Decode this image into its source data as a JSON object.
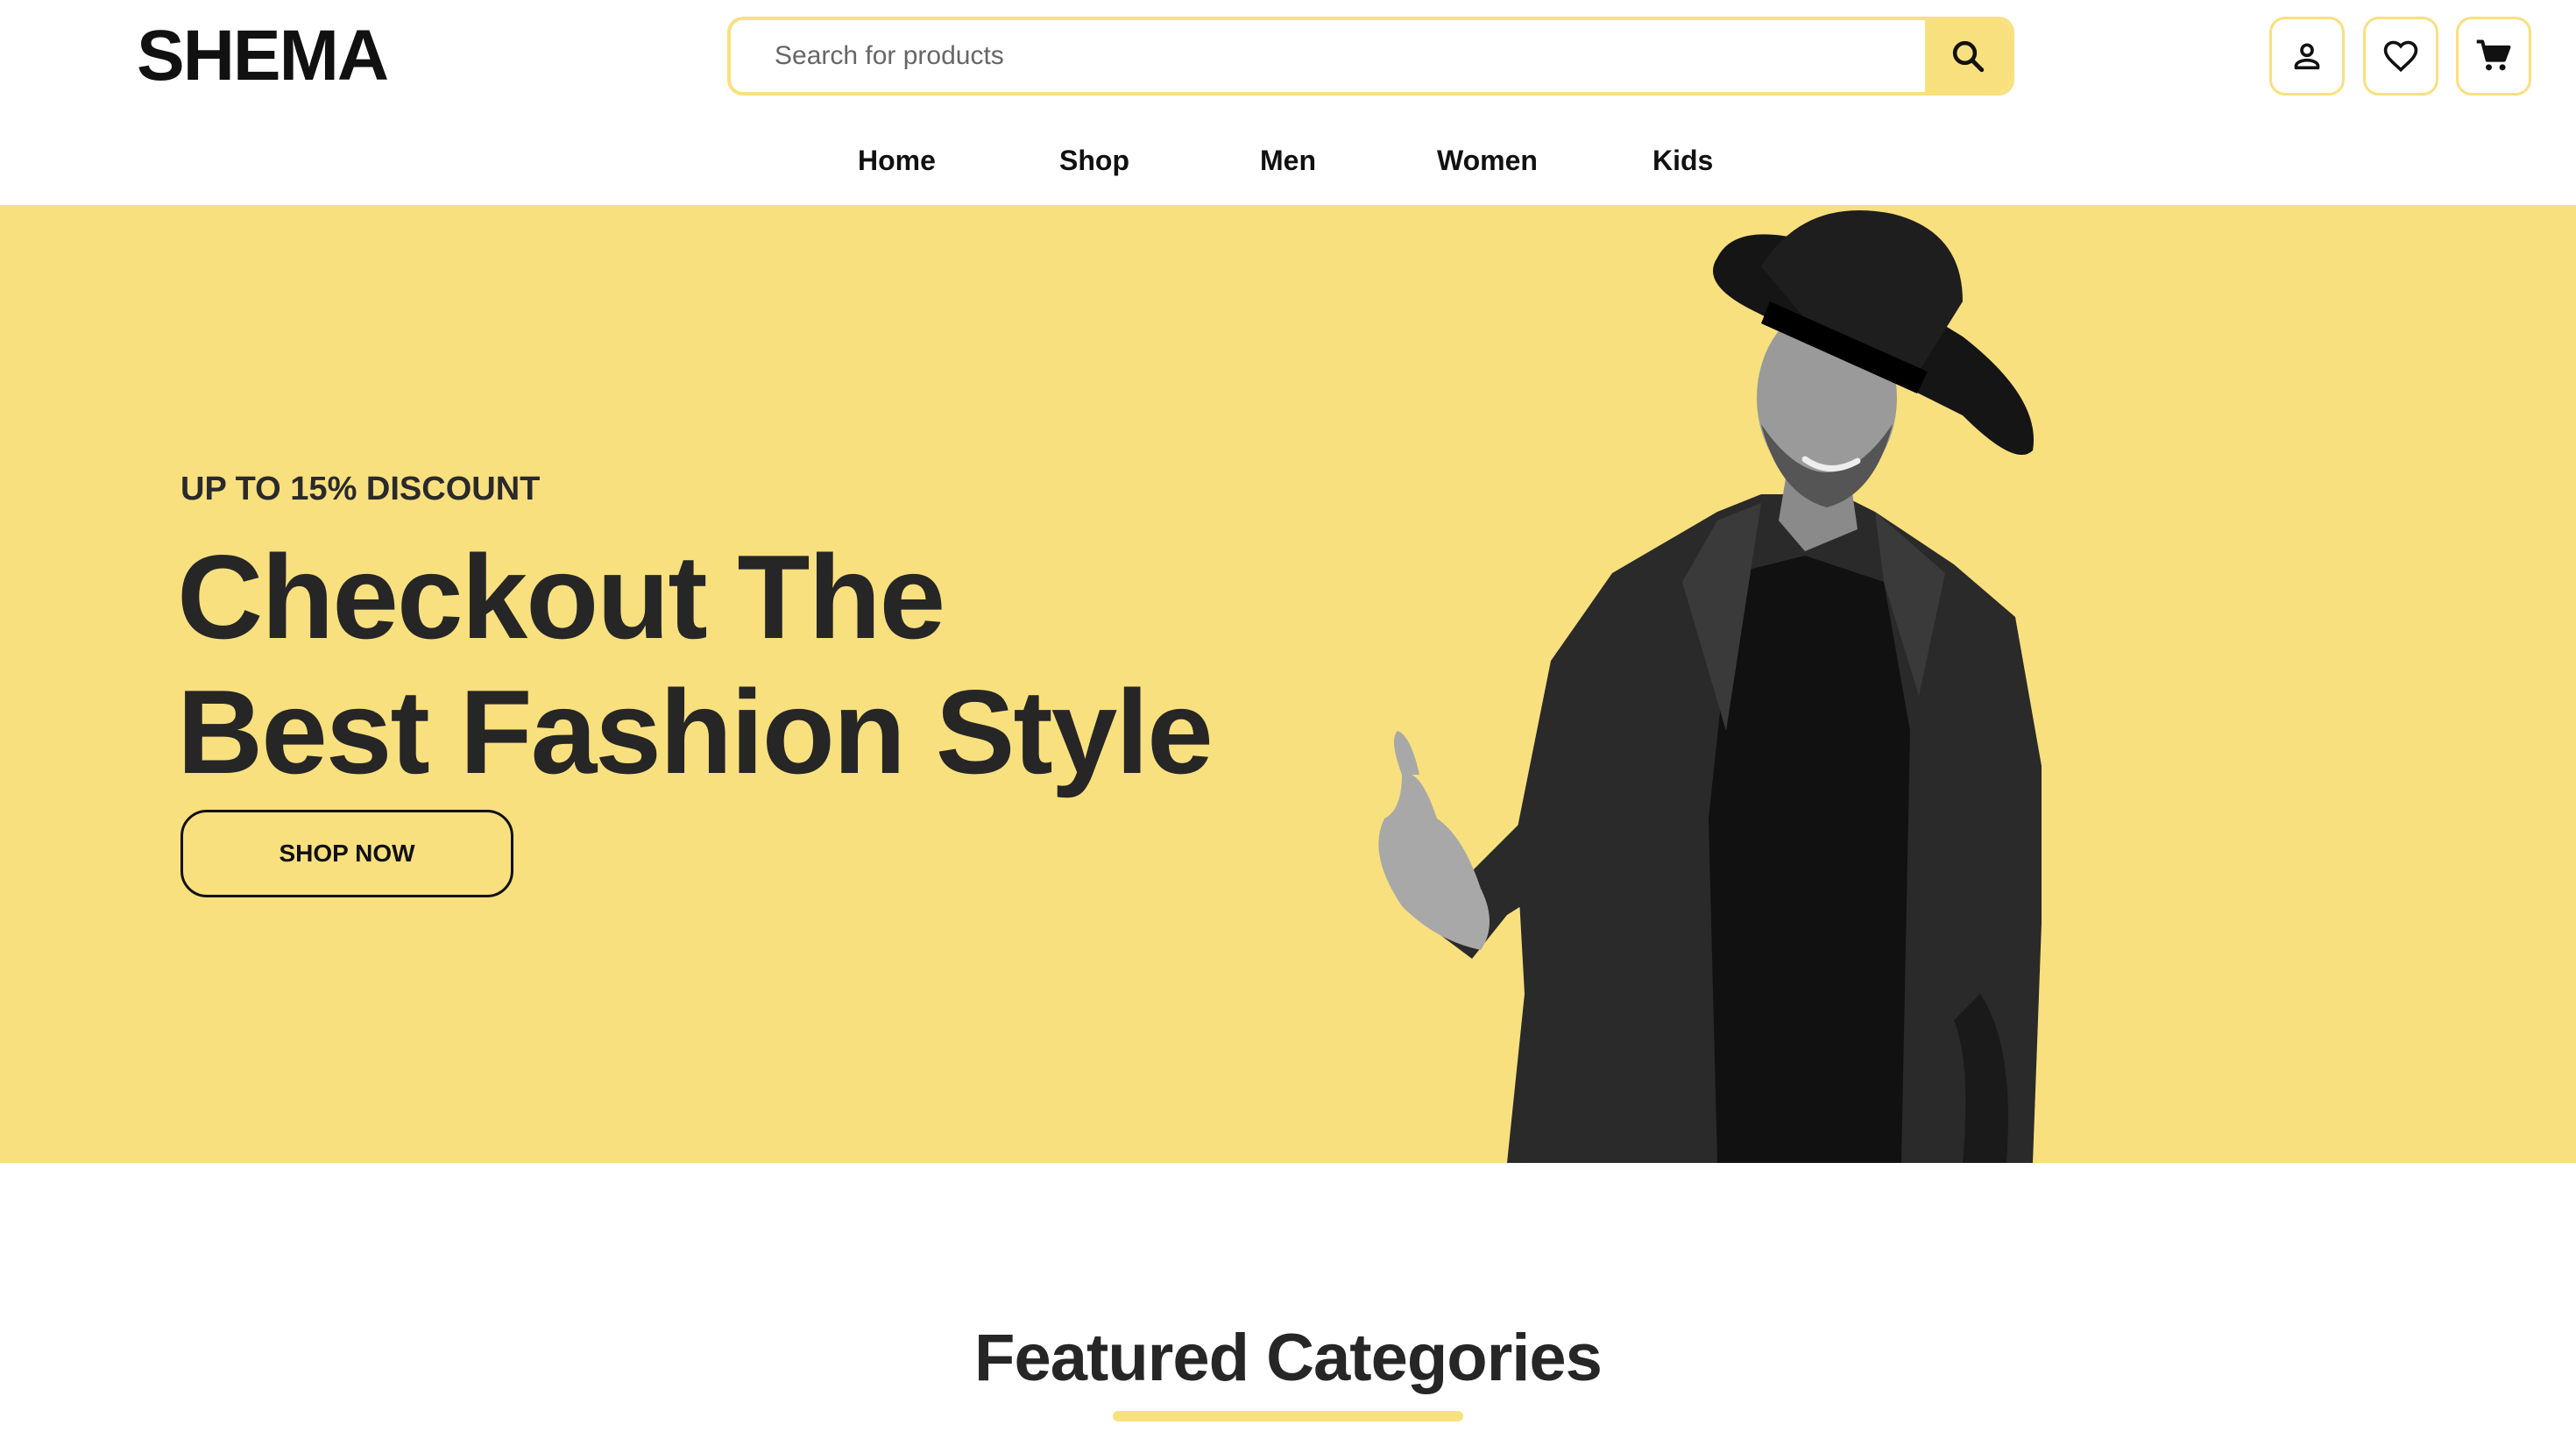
{
  "brand": {
    "name": "SHEMA"
  },
  "search": {
    "placeholder": "Search for products"
  },
  "header_icons": [
    "user-icon",
    "heart-icon",
    "cart-icon"
  ],
  "nav": {
    "items": [
      "Home",
      "Shop",
      "Men",
      "Women",
      "Kids"
    ]
  },
  "hero": {
    "eyebrow": "UP TO 15% DISCOUNT",
    "title_line1": "Checkout The",
    "title_line2": "Best Fashion Style",
    "cta_label": "SHOP NOW"
  },
  "featured": {
    "heading": "Featured Categories"
  },
  "colors": {
    "accent": "#f8e07f",
    "text": "#262626",
    "background": "#ffffff"
  }
}
